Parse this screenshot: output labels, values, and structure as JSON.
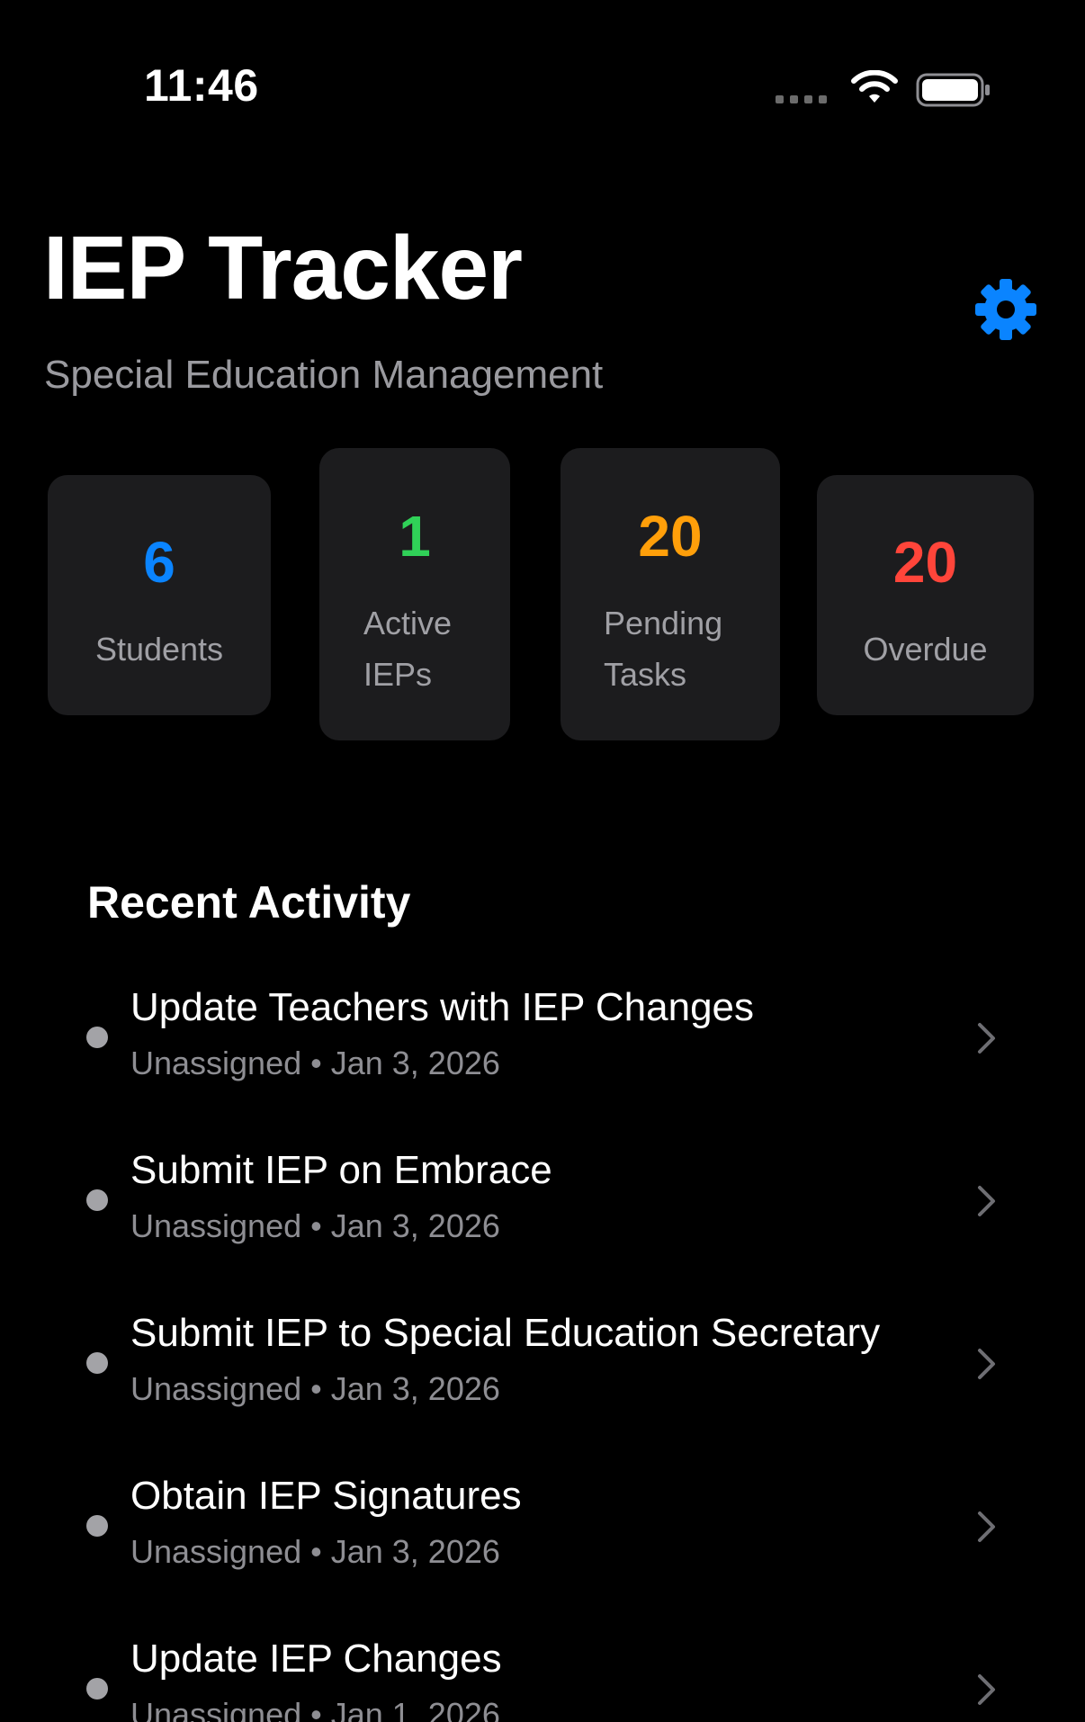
{
  "status_bar": {
    "time": "11:46"
  },
  "header": {
    "title": "IEP Tracker",
    "subtitle": "Special Education Management",
    "settings_icon": "gear-icon"
  },
  "colors": {
    "background": "#000000",
    "card": "#1c1c1e",
    "accent_blue": "#0a84ff",
    "green": "#30d158",
    "orange": "#ff9f0a",
    "red": "#ff453a",
    "secondary_text": "#8e8e93"
  },
  "stats": [
    {
      "value": "6",
      "label_lines": [
        "Students"
      ],
      "color": "#0a84ff"
    },
    {
      "value": "1",
      "label_lines": [
        "Active",
        "IEPs"
      ],
      "color": "#30d158"
    },
    {
      "value": "20",
      "label_lines": [
        "Pending",
        "Tasks"
      ],
      "color": "#ff9f0a"
    },
    {
      "value": "20",
      "label_lines": [
        "Overdue"
      ],
      "color": "#ff453a"
    }
  ],
  "recent_activity": {
    "title": "Recent Activity",
    "items": [
      {
        "title": "Update Teachers with IEP Changes",
        "assignee": "Unassigned",
        "separator": "•",
        "date": "Jan 3, 2026"
      },
      {
        "title": "Submit IEP on Embrace",
        "assignee": "Unassigned",
        "separator": "•",
        "date": "Jan 3, 2026"
      },
      {
        "title": "Submit IEP to Special Education Secretary",
        "assignee": "Unassigned",
        "separator": "•",
        "date": "Jan 3, 2026"
      },
      {
        "title": "Obtain IEP Signatures",
        "assignee": "Unassigned",
        "separator": "•",
        "date": "Jan 3, 2026"
      },
      {
        "title": "Update IEP Changes",
        "assignee": "Unassigned",
        "separator": "•",
        "date": "Jan 1, 2026"
      }
    ]
  }
}
